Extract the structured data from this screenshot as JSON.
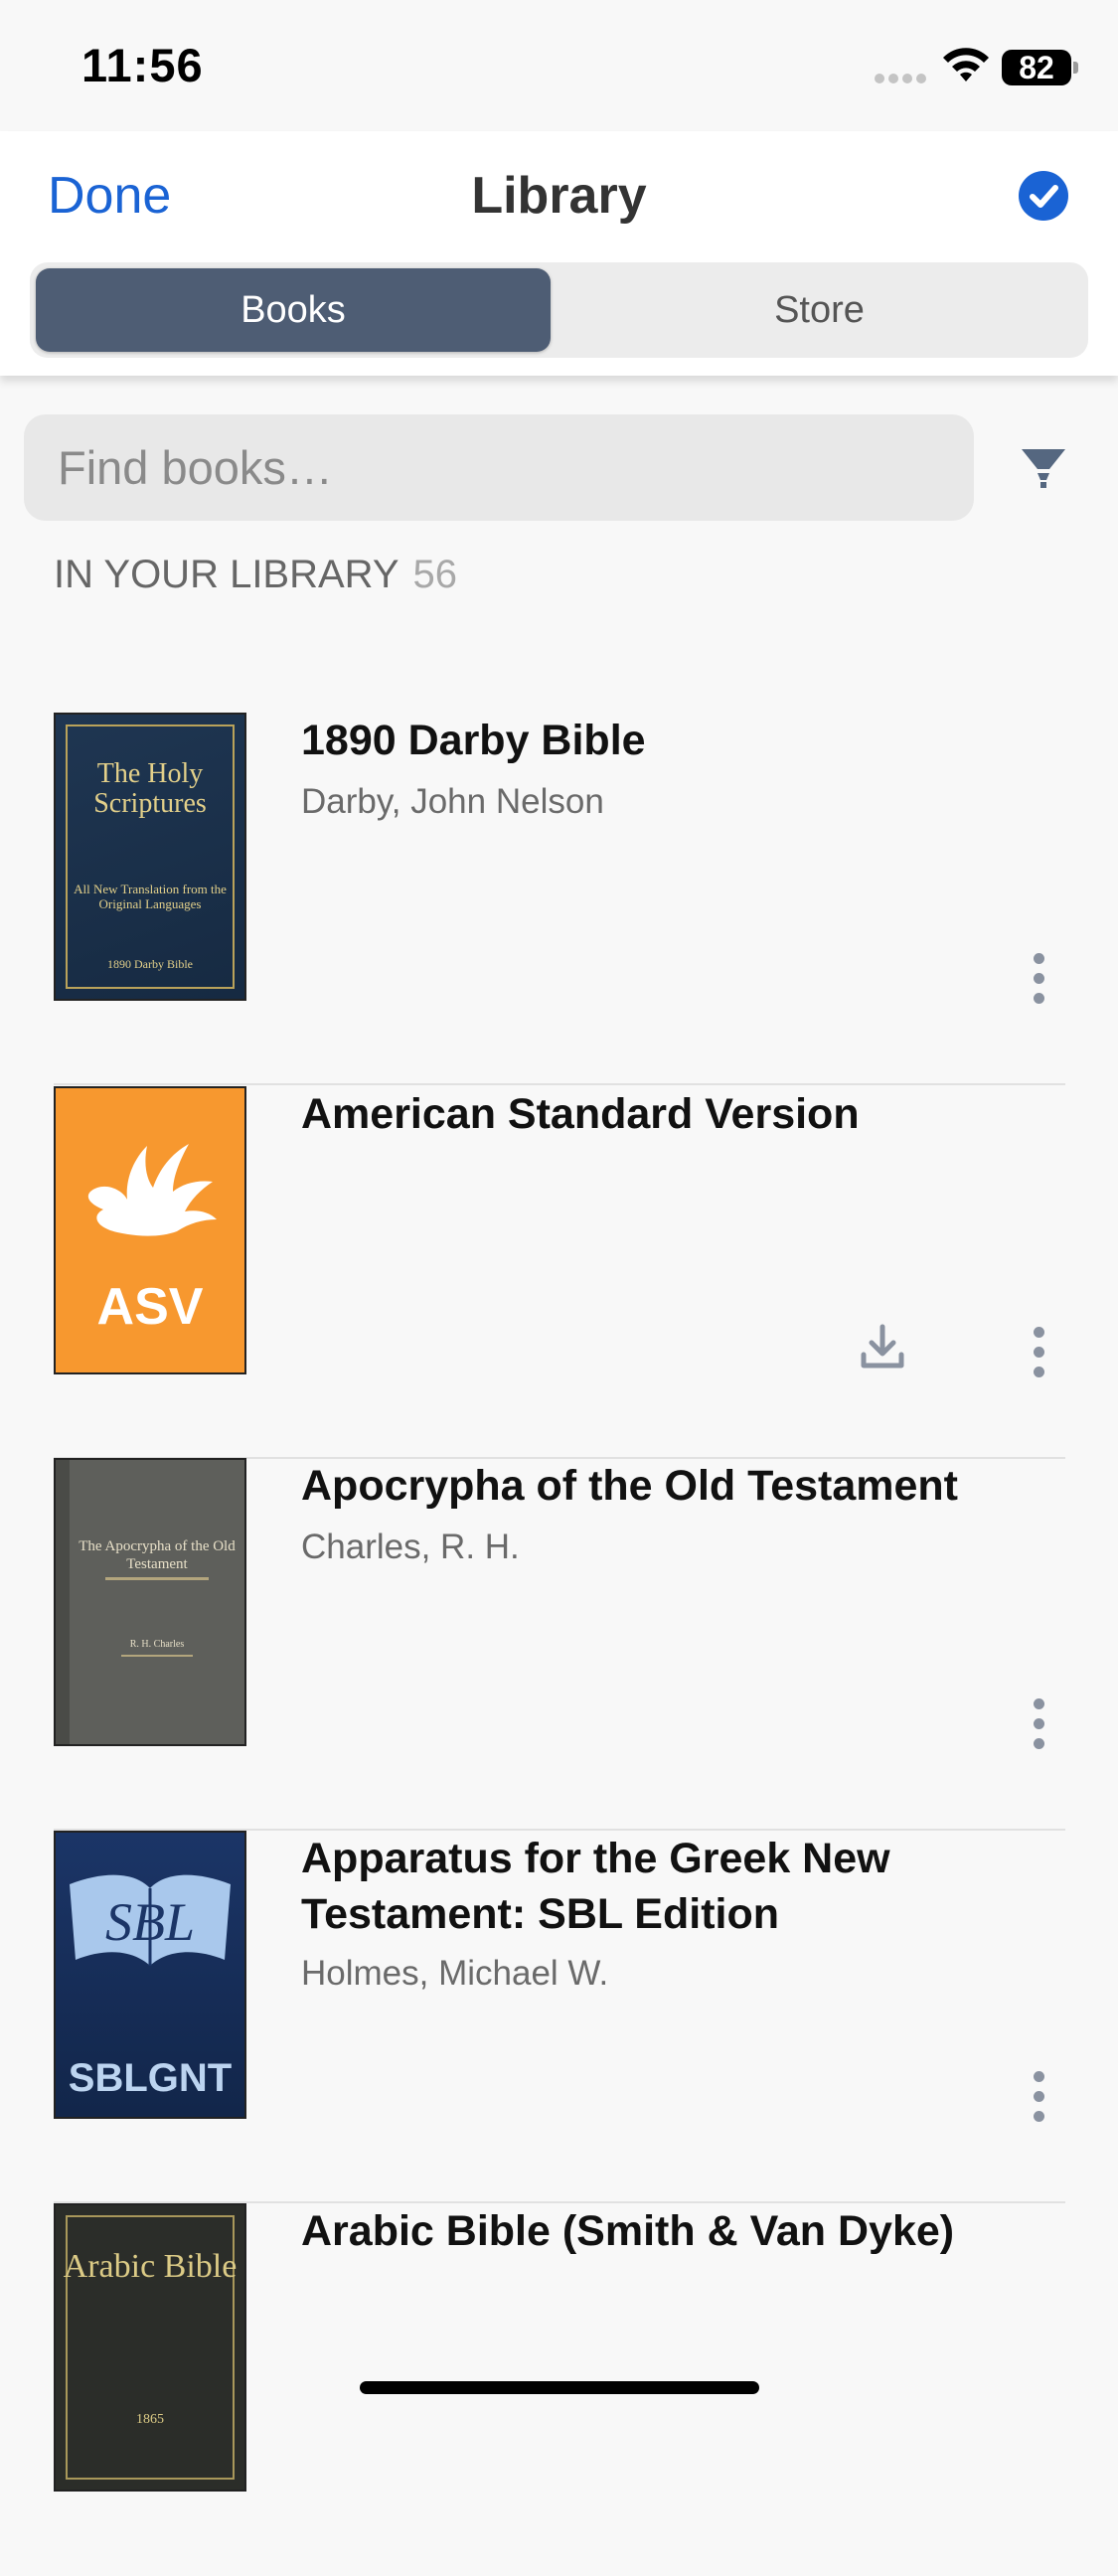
{
  "status_bar": {
    "time": "11:56",
    "battery": "82"
  },
  "header": {
    "done_label": "Done",
    "title": "Library",
    "accent_color": "#1a63d4"
  },
  "tabs": [
    {
      "label": "Books",
      "selected": true
    },
    {
      "label": "Store",
      "selected": false
    }
  ],
  "search": {
    "placeholder": "Find books…"
  },
  "section": {
    "label": "IN YOUR LIBRARY",
    "count": "56"
  },
  "books": [
    {
      "title": "1890 Darby Bible",
      "author": "Darby, John Nelson",
      "downloadable": false,
      "cover": {
        "title": "The Holy Scriptures",
        "subtitle": "All New Translation from the Original Languages",
        "footer": "1890 Darby Bible"
      }
    },
    {
      "title": "American Standard Version",
      "author": "",
      "downloadable": true,
      "cover": {
        "title": "ASV"
      }
    },
    {
      "title": "Apocrypha of the Old Testament",
      "author": "Charles, R. H.",
      "downloadable": false,
      "cover": {
        "title": "The Apocrypha of the Old Testament",
        "footer": "R. H. Charles"
      }
    },
    {
      "title": "Apparatus for the Greek New Testament: SBL Edition",
      "author": "Holmes, Michael W.",
      "downloadable": false,
      "cover": {
        "logo": "SBL",
        "title": "SBLGNT"
      }
    },
    {
      "title": "Arabic Bible (Smith & Van Dyke)",
      "author": "",
      "downloadable": false,
      "cover": {
        "title": "Arabic Bible",
        "footer": "1865"
      }
    }
  ]
}
